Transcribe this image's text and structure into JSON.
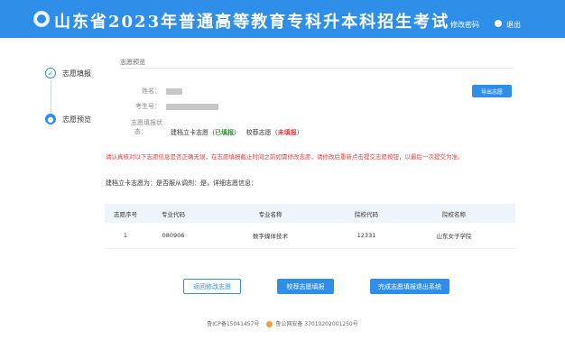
{
  "header": {
    "title": "山东省2023年普通高等教育专科升本科招生考试",
    "change_password": "修改密码",
    "logout": "退出"
  },
  "steps": [
    {
      "label": "志愿填报",
      "icon": "check-icon",
      "marker": "✓",
      "state": "done"
    },
    {
      "label": "志愿预览",
      "icon": "step-dot-icon",
      "marker": "●",
      "state": "current"
    }
  ],
  "section": {
    "title": "志愿预览"
  },
  "fields": {
    "name_label": "姓名：",
    "exam_label": "考生号：",
    "state_label_1": "志愿填报状",
    "state_label_2": "态：",
    "state_a_prefix": "建档立卡志愿（",
    "state_a_value": "已填报",
    "state_a_suffix": "）",
    "state_b_prefix": "校荐志愿（",
    "state_b_value": "未填报",
    "state_b_suffix": "）"
  },
  "export_button": "导出志愿",
  "warning": "请认真核对以下志愿信息是否正确无误，在志愿填报截止时间之前如需修改志愿，请修改后重新点击提交志愿按钮，以最后一次提交为准。",
  "choice_text": "建档立卡志愿为：是否服从调剂：是，详细志愿信息：",
  "table": {
    "headers": [
      "志愿序号",
      "专业代码",
      "专业名称",
      "院校代码",
      "院校名称"
    ],
    "rows": [
      [
        "1",
        "080906",
        "数字媒体技术",
        "12331",
        "山东女子学院"
      ]
    ]
  },
  "buttons": {
    "back": "返回修改志愿",
    "verify": "校荐志愿填报",
    "done": "完成志愿填报退出系统"
  },
  "footer": {
    "icp": "鲁ICP备15041457号",
    "police": "鲁公网安备 37010202001250号"
  },
  "colors": {
    "accent": "#2f8fe8",
    "warning": "#e23a3a",
    "ok": "#2a9d2a"
  }
}
